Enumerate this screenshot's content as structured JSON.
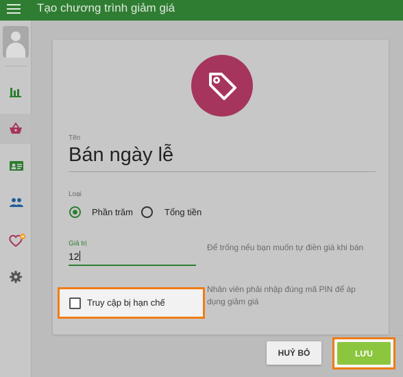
{
  "header": {
    "title": "Tạo chương trình giảm giá",
    "menu_icon": "hamburger-menu-icon"
  },
  "sidebar": {
    "items": [
      {
        "name": "reports",
        "icon": "bar-chart-icon",
        "color": "#2e7d32"
      },
      {
        "name": "products",
        "icon": "shopping-basket-icon",
        "color": "#a6355e",
        "active": true
      },
      {
        "name": "customers-card",
        "icon": "contact-card-icon",
        "color": "#2e7d32"
      },
      {
        "name": "staff",
        "icon": "people-icon",
        "color": "#1f5f99"
      },
      {
        "name": "loyalty",
        "icon": "heart-icon",
        "color": "#a6355e",
        "badge_color": "#f0a030"
      },
      {
        "name": "settings",
        "icon": "gear-icon",
        "color": "#555555"
      }
    ]
  },
  "form": {
    "icon": "price-tag-icon",
    "icon_bg": "#a6355e",
    "name_label": "Tên",
    "name_value": "Bán ngày lễ",
    "type_label": "Loại",
    "type_options": [
      "Phần trăm",
      "Tổng tiền"
    ],
    "type_selected": "Phần trăm",
    "value_label": "Giá trị",
    "value": "12",
    "value_hint": "Để trống nếu bạn muốn tự điền giá khi bán",
    "restricted_label": "Truy cập bị hạn chế",
    "restricted_checked": false,
    "restricted_hint": "Nhân viên phải nhập đúng mã PIN để áp dụng giảm giá"
  },
  "actions": {
    "cancel_label": "HUỶ BỎ",
    "save_label": "LƯU"
  },
  "colors": {
    "header": "#2f7d32",
    "accent_green": "#2e7d32",
    "save_button": "#8cc63e",
    "highlight": "#f07c13"
  }
}
